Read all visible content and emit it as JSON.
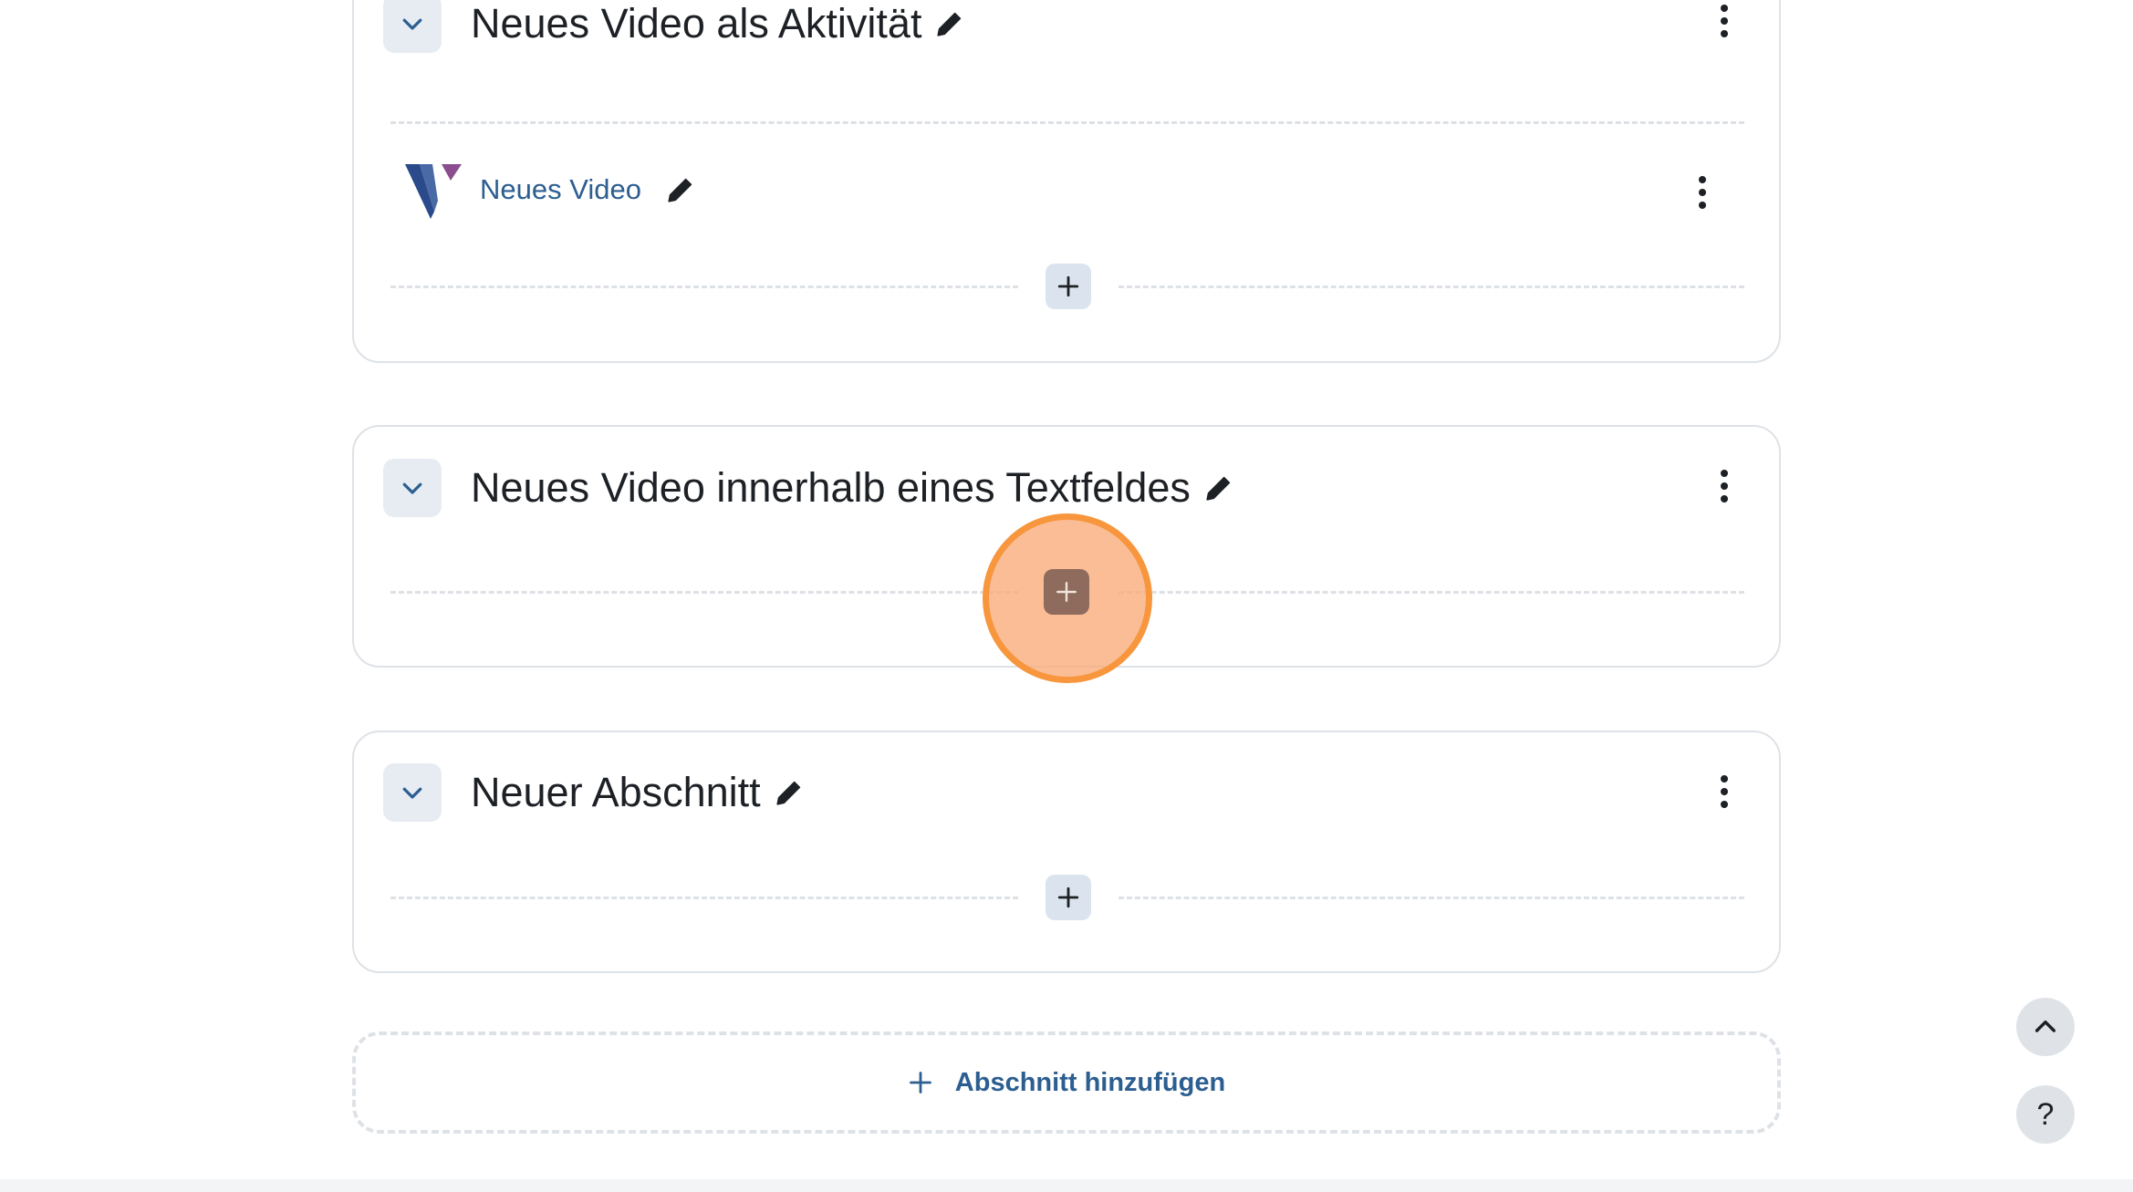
{
  "sections": [
    {
      "title": "Neues Video als Aktivität",
      "activities": [
        {
          "name": "Neues Video",
          "icon": "video-activity-logo"
        }
      ]
    },
    {
      "title": "Neues Video innerhalb eines Textfeldes",
      "activities": []
    },
    {
      "title": "Neuer Abschnitt",
      "activities": []
    }
  ],
  "add_section_label": "Abschnitt hinzufügen",
  "help_label": "?",
  "icons": {
    "collapse": "chevron-down-icon",
    "edit": "pencil-icon",
    "menu": "kebab-menu-icon",
    "add": "plus-icon",
    "back_to_top": "chevron-up-icon"
  },
  "colors": {
    "link": "#2c5e90",
    "highlight_ring": "#f7963d",
    "highlight_fill": "#f9aa78",
    "logo_blue": "#2a4a8c",
    "logo_purple": "#8a4d8e"
  }
}
